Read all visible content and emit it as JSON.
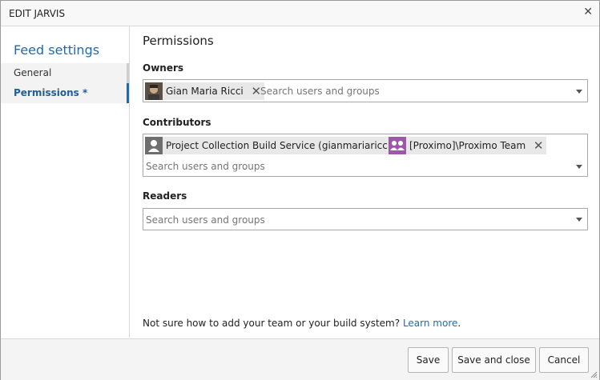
{
  "dialog": {
    "title": "EDIT JARVIS",
    "close_icon": "close-icon"
  },
  "sidebar": {
    "title": "Feed settings",
    "items": [
      {
        "label": "General",
        "active": false
      },
      {
        "label": "Permissions *",
        "active": true
      }
    ]
  },
  "permissions": {
    "title": "Permissions",
    "owners": {
      "label": "Owners",
      "chips": [
        {
          "name": "Gian Maria Ricci",
          "avatar": "user-photo-avatar"
        }
      ],
      "placeholder": "Search users and groups"
    },
    "contributors": {
      "label": "Contributors",
      "chips": [
        {
          "name": "Project Collection Build Service (gianmariaricci)",
          "avatar": "build-service-avatar"
        },
        {
          "name": "[Proximo]\\Proximo Team",
          "avatar": "team-avatar"
        }
      ],
      "placeholder": "Search users and groups"
    },
    "readers": {
      "label": "Readers",
      "chips": [],
      "placeholder": "Search users and groups"
    }
  },
  "help": {
    "text": "Not sure how to add your team or your build system?",
    "link": "Learn more",
    "suffix": "."
  },
  "buttons": {
    "save": "Save",
    "save_close": "Save and close",
    "cancel": "Cancel"
  },
  "colors": {
    "accent": "#1f6aa8",
    "team_avatar": "#9b59a8",
    "build_avatar": "#6e6e6e"
  }
}
